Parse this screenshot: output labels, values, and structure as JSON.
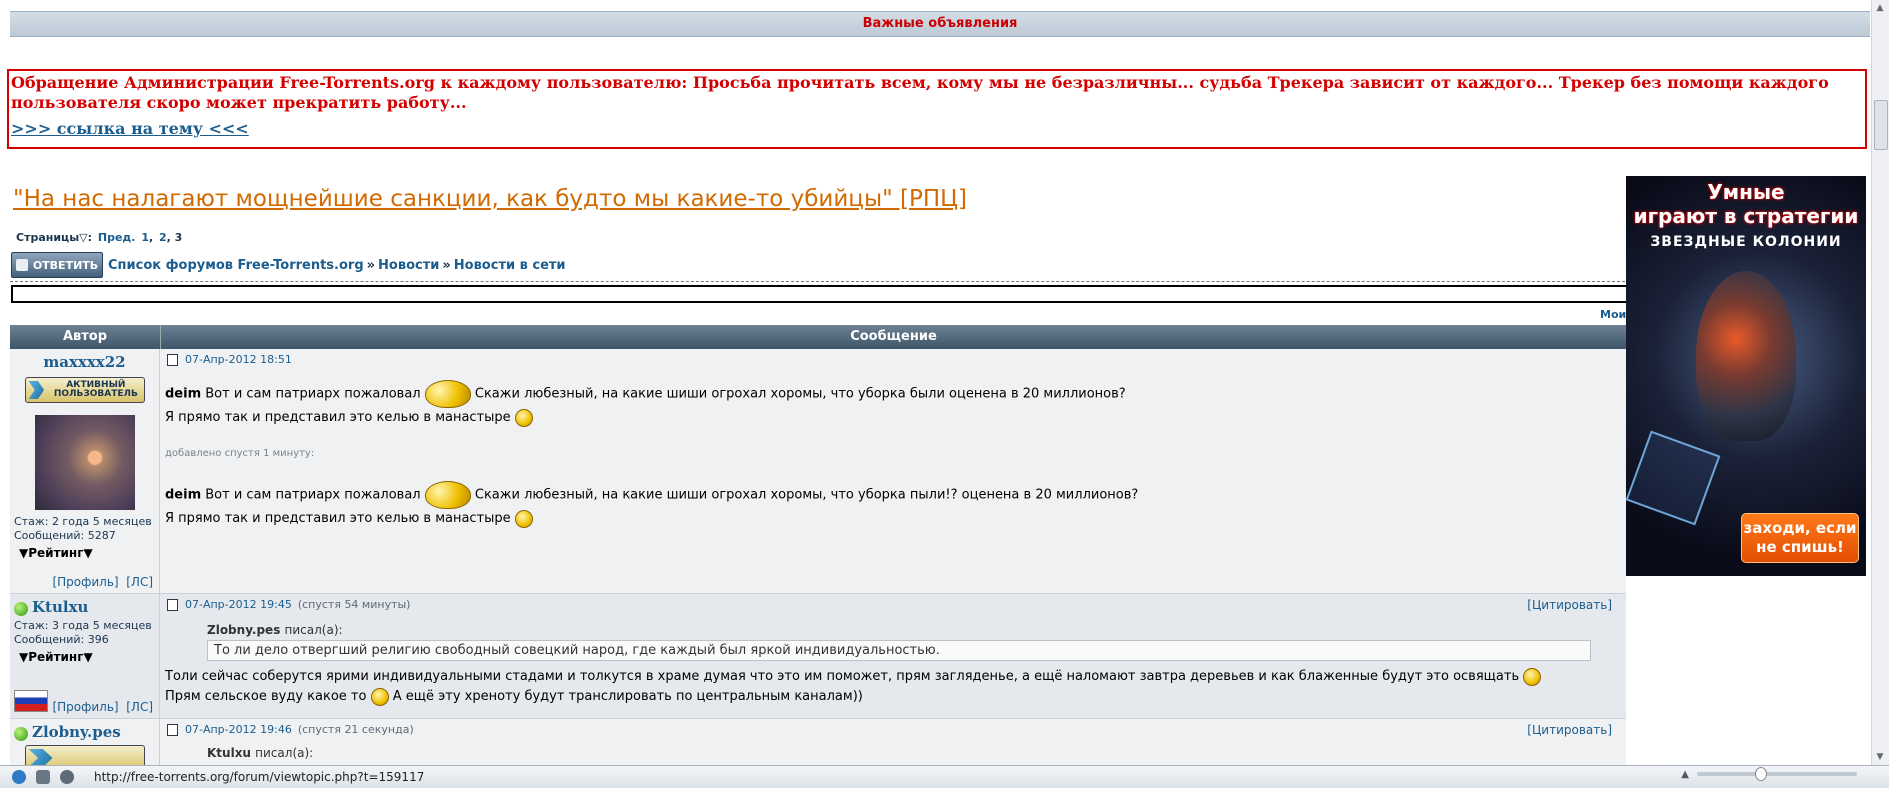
{
  "announcement": {
    "header": "Важные объявления",
    "text": "Обращение Администрации Free-Torrents.org к каждому пользователю: Просьба прочитать всем, кому мы не безразличны... судьба Трекера зависит от каждого... Трекер без помощи каждого пользователя скоро может прекратить работу...",
    "link": ">>> ссылка на тему <<<"
  },
  "topic": {
    "title": "\"На нас налагают мощнейшие санкции, как будто мы какие-то убийцы\" [РПЦ]"
  },
  "pagination": {
    "label": "Страницы",
    "prev": "Пред.",
    "pages": [
      "1",
      "2"
    ],
    "current": "3"
  },
  "nav": {
    "reply": "ОТВЕТИТЬ",
    "crumbs": [
      "Список форумов Free-Torrents.org",
      "Новости",
      "Новости в сети"
    ]
  },
  "moi": "Мои",
  "table": {
    "col_author": "Автор",
    "col_message": "Сообщение"
  },
  "posts": [
    {
      "author": "maxxxx22",
      "rank": "АКТИВНЫЙ ПОЛЬЗОВАТЕЛЬ",
      "stazh": "Стаж: 2 года 5 месяцев",
      "messages": "Сообщений: 5287",
      "rating": "▼Рейтинг▼",
      "profile": "[Профиль]",
      "pm": "[ЛС]",
      "date": "07-Апр-2012 18:51",
      "line1_name": "deim",
      "line1_a": "Вот и сам патриарх пожаловал",
      "line1_b": "Скажи любезный, на какие шиши огрохал хоромы, что уборка были оценена в 20 миллионов?",
      "line2": "Я прямо так и представил это келью в манастыре",
      "added": "добавлено спустя 1 минуту:",
      "line3_name": "deim",
      "line3_a": "Вот и сам патриарх пожаловал",
      "line3_b": "Скажи любезный, на какие шиши огрохал хоромы, что уборка пыли!? оценена в 20 миллионов?",
      "line4": "Я прямо так и представил это келью в манастыре"
    },
    {
      "author": "Ktulxu",
      "stazh": "Стаж: 3 года 5 месяцев",
      "messages": "Сообщений: 396",
      "rating": "▼Рейтинг▼",
      "profile": "[Профиль]",
      "pm": "[ЛС]",
      "date": "07-Апр-2012 19:45",
      "delta": "(спустя 54 минуты)",
      "quote_btn": "[Цитировать]",
      "quote_author": "Zlobny.pes",
      "quote_wrote": "писал(а):",
      "quote_text": "То ли дело отвергший религию свободный совецкий народ, где каждый был яркой индивидуальностью.",
      "line1": "Толи сейчас соберутся ярими индивидуальными стадами и толкутся в храме думая что это им поможет, прям загляденье, а ещё наломают завтра деревьев и как блаженные будут это освящать",
      "line2_a": "Прям сельское вуду какое то",
      "line2_b": "А ещё эту хреноту будут транслировать по центральным каналам))"
    },
    {
      "author": "Zlobny.pes",
      "date": "07-Апр-2012 19:46",
      "delta": "(спустя 21 секунда)",
      "quote_btn": "[Цитировать]",
      "quote_author": "Ktulxu",
      "quote_wrote": "писал(а):"
    }
  ],
  "ad": {
    "line1": "Умные",
    "line2": "играют в стратегии",
    "line3": "ЗВЕЗДНЫЕ КОЛОНИИ",
    "cta1": "заходи, если",
    "cta2": "не спишь!"
  },
  "statusbar": {
    "url": "http://free-torrents.org/forum/viewtopic.php?t=159117"
  }
}
